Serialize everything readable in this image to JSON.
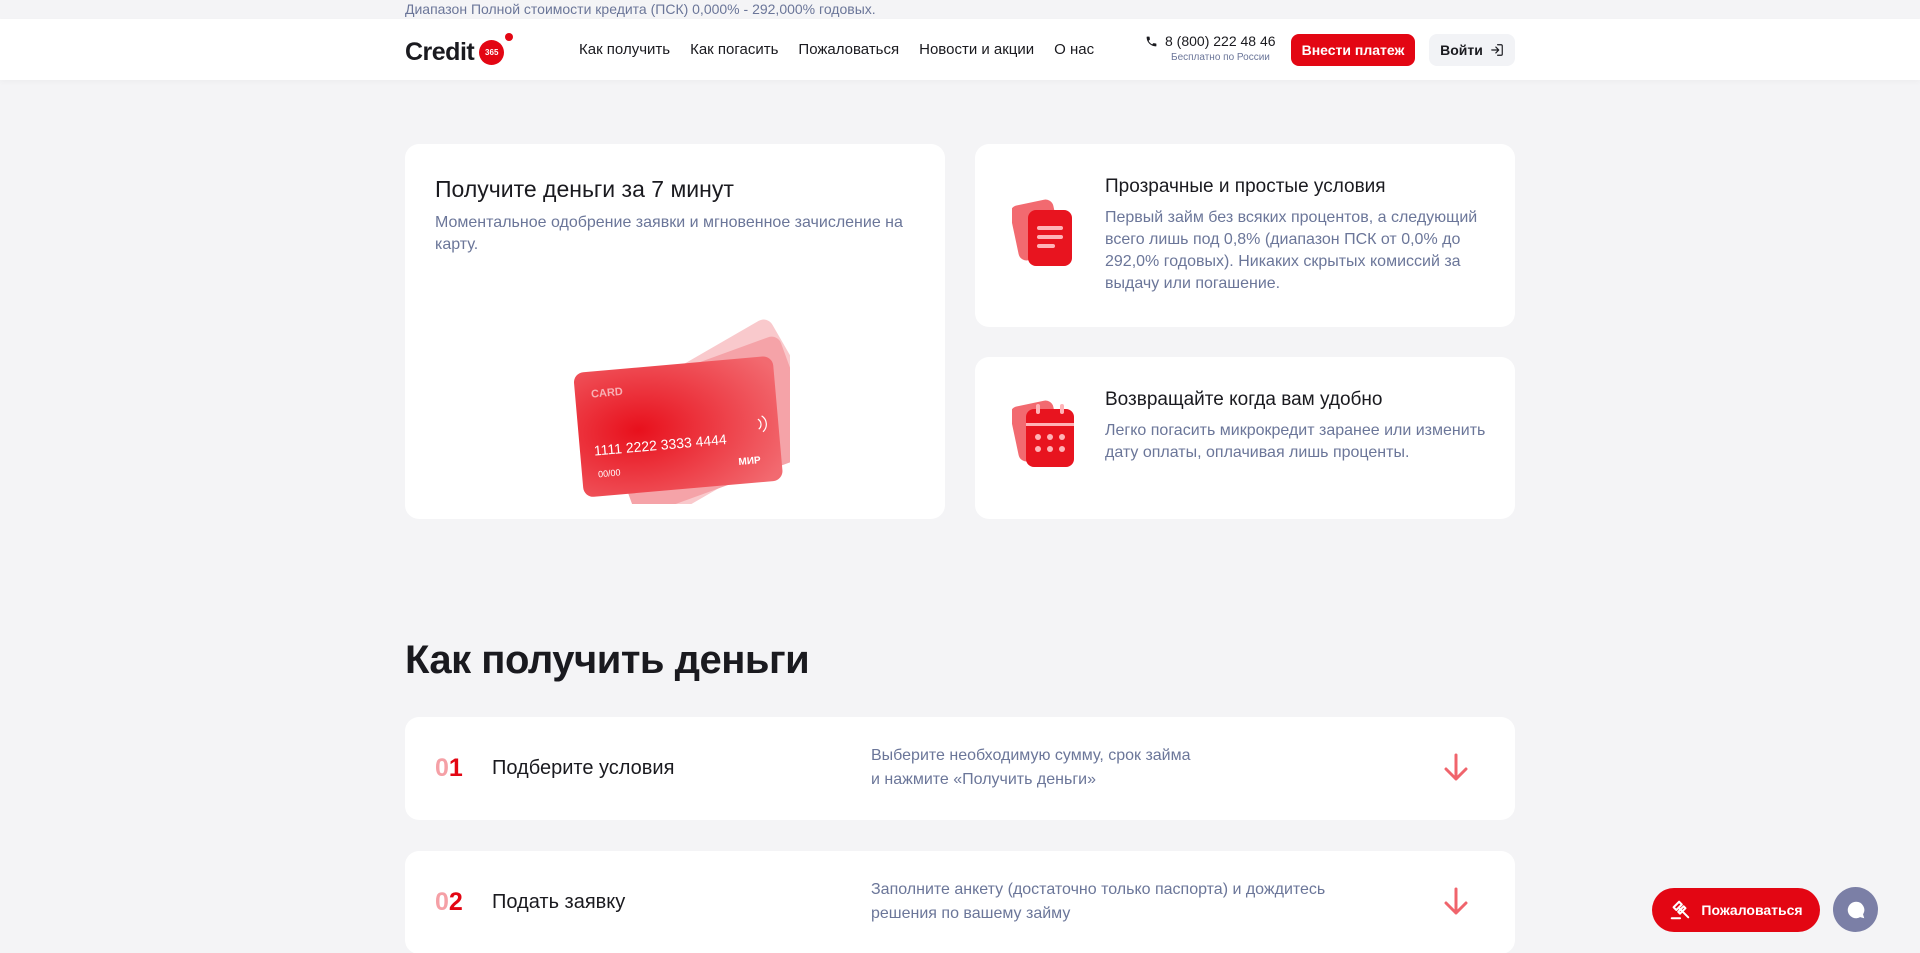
{
  "top_notice": "Диапазон Полной стоимости кредита (ПСК) 0,000% - 292,000% годовых.",
  "header": {
    "logo_text": "Credit",
    "logo_badge": "365",
    "nav": [
      "Как получить",
      "Как погасить",
      "Пожаловаться",
      "Новости и акции",
      "О нас"
    ],
    "phone": "8 (800) 222 48 46",
    "phone_note": "Бесплатно по России",
    "pay_button": "Внести платеж",
    "login_button": "Войти"
  },
  "promo": {
    "title": "Получите деньги за 7 минут",
    "text": "Моментальное одобрение заявки и мгновенное зачисление на карту.",
    "card_label": "CARD",
    "card_number": "1111 2222 3333 4444",
    "card_expiry": "00/00",
    "card_brand": "МИР"
  },
  "features": [
    {
      "title": "Прозрачные и простые условия",
      "text": "Первый займ без всяких процентов, а следующий всего лишь под 0,8% (диапазон ПСК от 0,0% до 292,0% годовых). Никаких скрытых комиссий за выдачу или погашение.",
      "icon": "document-icon"
    },
    {
      "title": "Возвращайте когда вам удобно",
      "text": "Легко погасить микрокредит заранее или изменить дату оплаты, оплачивая лишь проценты.",
      "icon": "calendar-icon"
    }
  ],
  "how_to": {
    "title": "Как получить деньги",
    "steps": [
      {
        "num_zero": "0",
        "num": "1",
        "title": "Подберите условия",
        "desc_line1": "Выберите необходимую сумму, срок займа",
        "desc_line2": "и нажмите «Получить деньги»"
      },
      {
        "num_zero": "0",
        "num": "2",
        "title": "Подать заявку",
        "desc_line1": "Заполните анкету (достаточно только паспорта) и дождитесь",
        "desc_line2": "решения по вашему займу"
      }
    ]
  },
  "floating": {
    "complain_button": "Пожаловаться"
  },
  "colors": {
    "accent": "#e30613",
    "muted_text": "#6b7699",
    "background": "#f4f4f6"
  }
}
